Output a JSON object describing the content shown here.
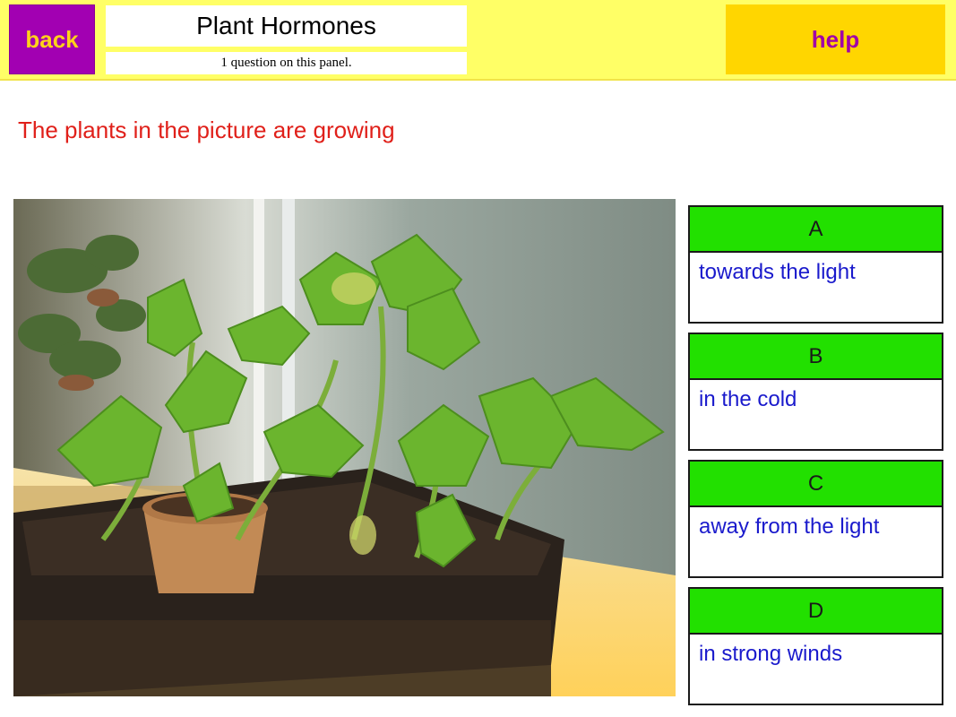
{
  "header": {
    "back_label": "back",
    "title": "Plant Hormones",
    "subtitle": "1 question on this panel.",
    "help_label": "help"
  },
  "question": {
    "text": "The plants in the picture are growing"
  },
  "answers": [
    {
      "letter": "A",
      "text": "towards the light"
    },
    {
      "letter": "B",
      "text": "in the cold"
    },
    {
      "letter": "C",
      "text": "away from the light"
    },
    {
      "letter": "D",
      "text": "in strong winds"
    }
  ],
  "colors": {
    "topbar": "#ffff66",
    "back_bg": "#a200b2",
    "back_text": "#ffd21a",
    "help_bg": "#ffd600",
    "help_text": "#a000a8",
    "question_text": "#e0201a",
    "answer_header": "#22e000",
    "answer_text": "#1a1acc"
  }
}
